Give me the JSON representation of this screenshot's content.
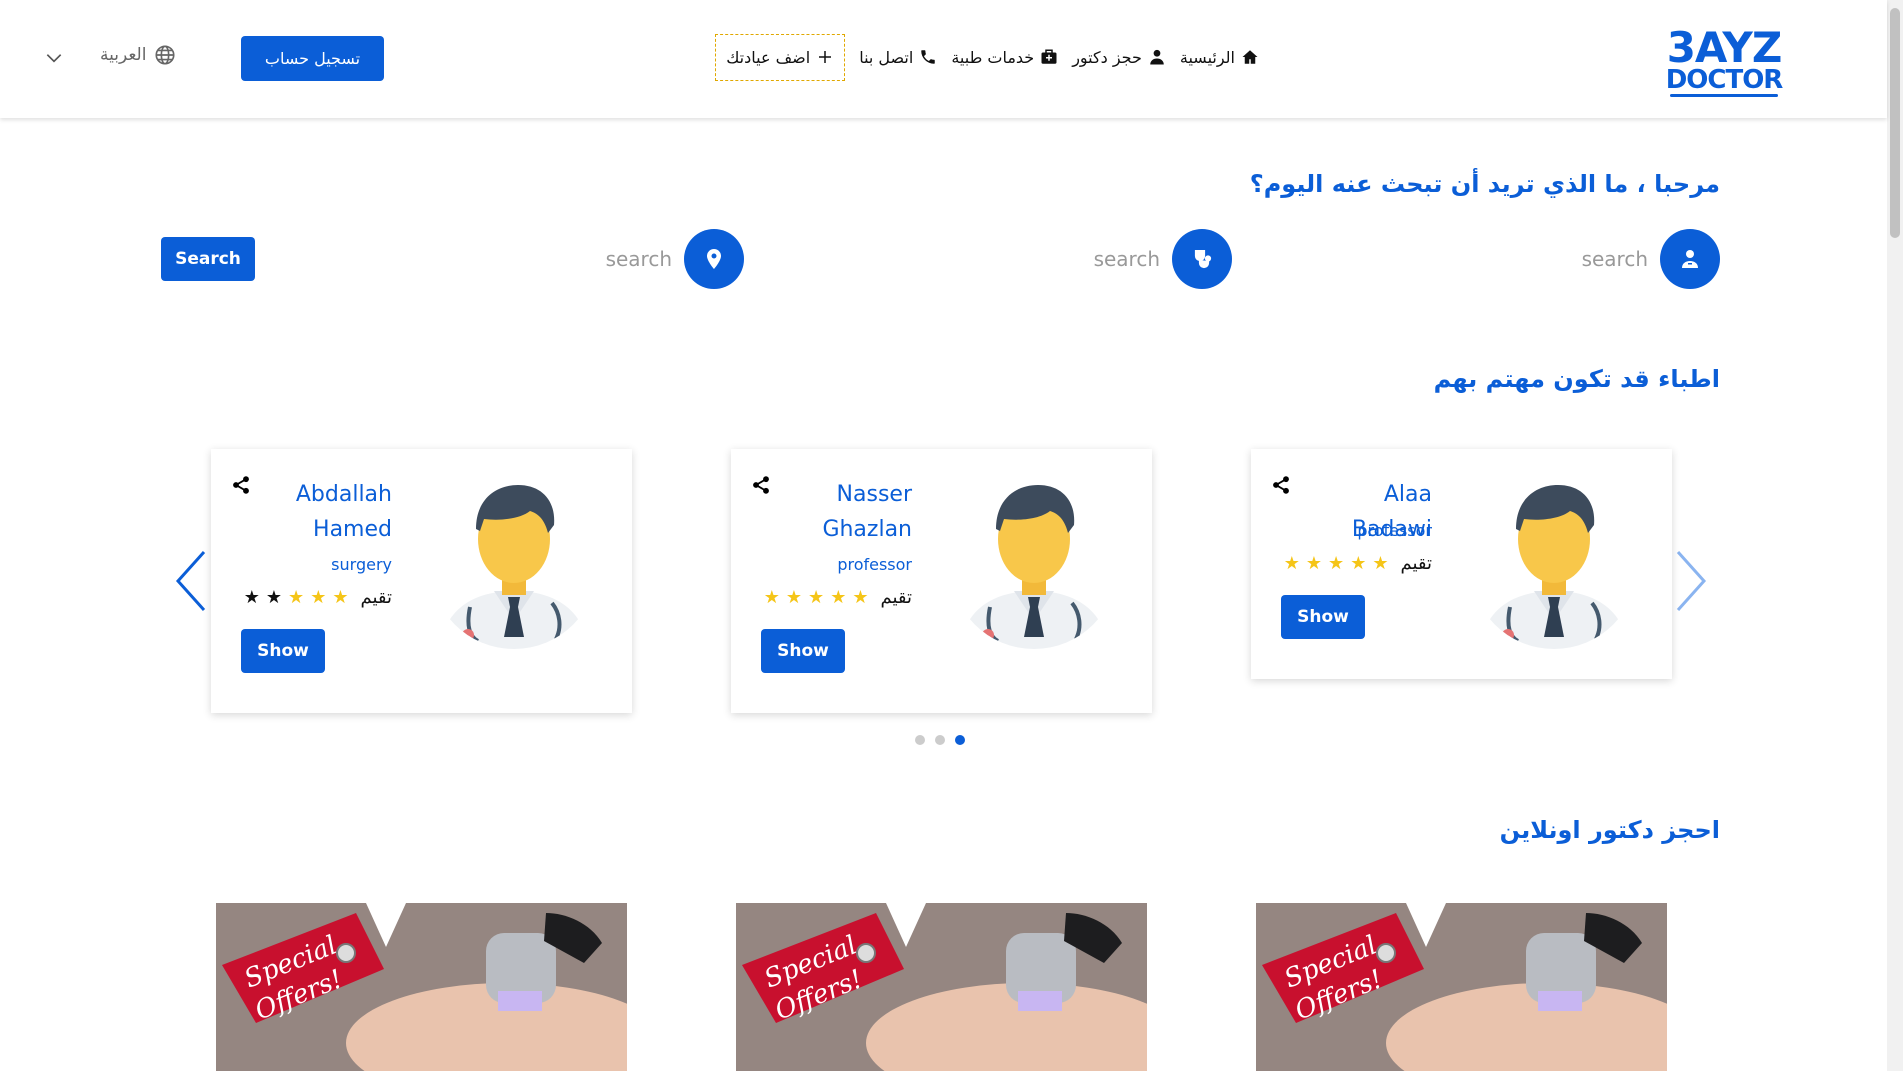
{
  "brand": {
    "line1": "3AYZ",
    "line2": "DOCTOR",
    "color": "#0b5ed7"
  },
  "nav": {
    "items": [
      {
        "label": "الرئيسية",
        "icon": "home-icon"
      },
      {
        "label": "حجز دكتور",
        "icon": "doctor-icon"
      },
      {
        "label": "خدمات طبية",
        "icon": "medical-kit-icon"
      },
      {
        "label": "اتصل بنا",
        "icon": "phone-icon"
      },
      {
        "label": "اضف عيادتك",
        "icon": "plus-icon"
      }
    ],
    "signup_label": "تسجيل حساب",
    "language": "العربية"
  },
  "greeting": "مرحبا ، ما الذي تريد أن تبحث عنه اليوم؟",
  "search": {
    "fields": [
      {
        "placeholder": "search",
        "icon": "doctor-user-icon"
      },
      {
        "placeholder": "search",
        "icon": "stethoscope-icon"
      },
      {
        "placeholder": "search",
        "icon": "location-pin-icon"
      }
    ],
    "button_label": "Search"
  },
  "doctors_section": {
    "title": "اطباء قد تكون مهتم بهم",
    "rating_label": "تقيم",
    "show_label": "Show",
    "cards": [
      {
        "name": "Alaa Badawi",
        "specialty": "professor",
        "stars": 5
      },
      {
        "name": "Nasser Ghazlan",
        "specialty": "professor",
        "stars": 5
      },
      {
        "name": "Abdallah Hamed",
        "specialty": "surgery",
        "stars": 3
      }
    ],
    "pagination": {
      "total": 3,
      "active": 3
    }
  },
  "online_section": {
    "title": "احجز دكتور اونلاين",
    "offer_text_1": "Special",
    "offer_text_2": "Offers!"
  }
}
